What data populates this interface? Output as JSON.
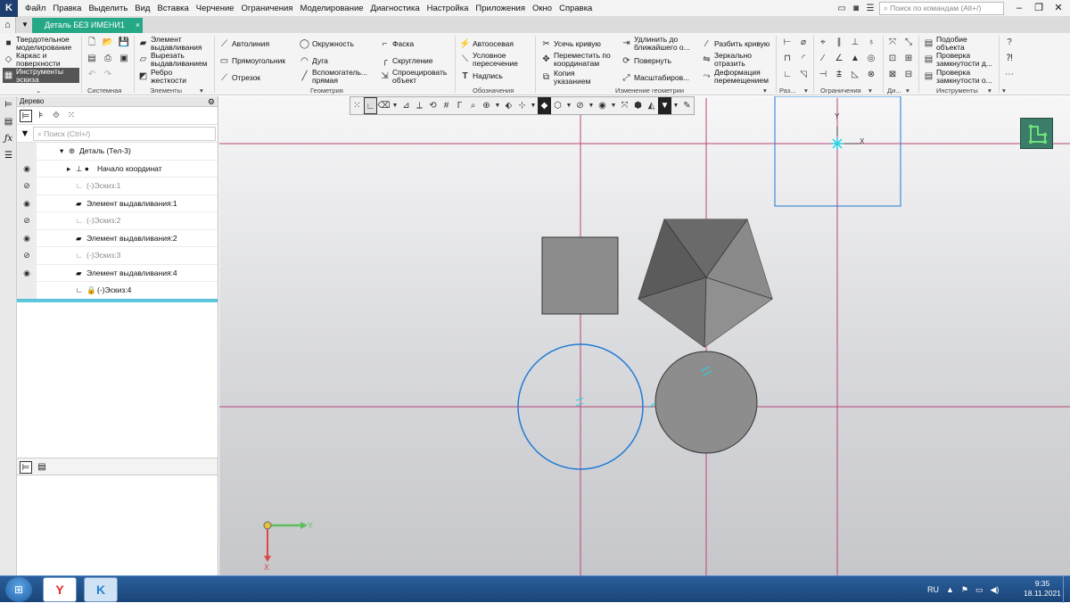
{
  "app": {
    "logo": "K"
  },
  "menu": [
    "Файл",
    "Правка",
    "Выделить",
    "Вид",
    "Вставка",
    "Черчение",
    "Ограничения",
    "Моделирование",
    "Диагностика",
    "Настройка",
    "Приложения",
    "Окно",
    "Справка"
  ],
  "command_search": {
    "placeholder": "Поиск по командам (Alt+/)"
  },
  "tabs": {
    "home_icon": "home-icon",
    "doc_title": "Деталь БЕЗ ИМЕНИ1",
    "close": "×"
  },
  "ribbon": {
    "modes": {
      "solid": "Твердотельное моделирование",
      "wire": "Каркас и поверхности",
      "sketch": "Инструменты эскиза"
    },
    "groups": {
      "system": "Системная",
      "elements": "Элементы",
      "geometry": "Геометрия",
      "annotation": "Обозначения",
      "edit": "Изменение геометрии",
      "dim": "Раз...",
      "constraints": "Ограничения",
      "diag": "Ди...",
      "tools": "Инструменты"
    },
    "elements": {
      "extrude": "Элемент выдавливания",
      "cut": "Вырезать выдавливанием",
      "rib": "Ребро жесткости"
    },
    "geometry": {
      "autoline": "Автолиния",
      "rect": "Прямоугольник",
      "segment": "Отрезок",
      "circle": "Окружность",
      "arc": "Дуга",
      "aux_line": "Вспомогатель... прямая",
      "chamfer": "Фаска",
      "fillet": "Скругление",
      "project": "Спроецировать объект"
    },
    "annotation": {
      "axis": "Автоосевая",
      "intersection": "Условное пересечение",
      "text": "Надпись"
    },
    "edit": {
      "trim": "Усечь кривую",
      "move_coords": "Переместить по координатам",
      "copy": "Копия указанием",
      "extend": "Удлинить до ближайшего о...",
      "rotate": "Повернуть",
      "scale": "Масштабиров...",
      "split": "Разбить кривую",
      "mirror": "Зеркально отразить",
      "deform": "Деформация перемещением"
    },
    "tools": {
      "similar": "Подобие объекта",
      "check_closed1": "Проверка замкнутости д...",
      "check_closed2": "Проверка замкнутости о..."
    }
  },
  "panel": {
    "title": "Дерево",
    "search_placeholder": "Поиск (Ctrl+/)",
    "tree": [
      {
        "label": "Деталь (Тел-3)",
        "icon": "part-icon",
        "visible": null
      },
      {
        "label": "Начало координат",
        "icon": "origin-icon",
        "visible": true
      },
      {
        "label": "(-)Эскиз:1",
        "icon": "sketch-icon",
        "visible": false
      },
      {
        "label": "Элемент выдавливания:1",
        "icon": "extrude-icon",
        "visible": true
      },
      {
        "label": "(-)Эскиз:2",
        "icon": "sketch-icon",
        "visible": false
      },
      {
        "label": "Элемент выдавливания:2",
        "icon": "extrude-icon",
        "visible": true
      },
      {
        "label": "(-)Эскиз:3",
        "icon": "sketch-icon",
        "visible": false
      },
      {
        "label": "Элемент выдавливания:4",
        "icon": "extrude-icon",
        "visible": true
      },
      {
        "label": "(-)Эскиз:4",
        "icon": "sketch-icon",
        "visible": null
      }
    ]
  },
  "viewport": {
    "axis_labels": {
      "y_top": "Y",
      "x_top": "X",
      "y_bottom": "Y",
      "x_bottom": "X"
    },
    "colors": {
      "crosshair": "#b8457a",
      "sketch": "#1f7ad6",
      "highlight": "#29d0e0",
      "accent": "#24a886"
    }
  },
  "taskbar": {
    "lang": "RU",
    "time": "9:35",
    "date": "18.11.2021",
    "apps": [
      "yandex-browser-icon",
      "kompas-icon"
    ]
  }
}
